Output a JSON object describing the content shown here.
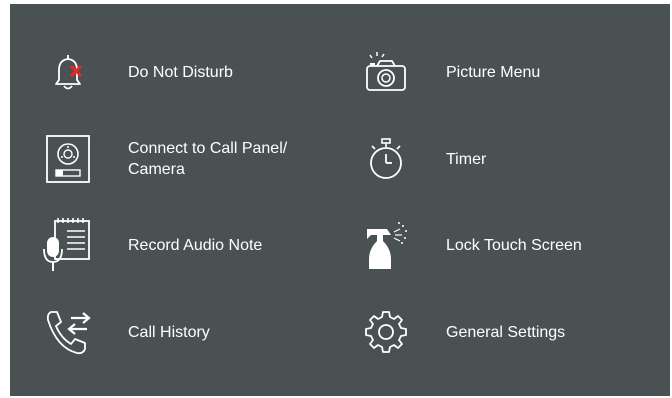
{
  "menu": {
    "left": [
      {
        "label": "Do Not Disturb",
        "icon": "bell-muted-icon"
      },
      {
        "label": "Connect to Call Panel/\nCamera",
        "icon": "call-panel-icon"
      },
      {
        "label": "Record Audio Note",
        "icon": "audio-note-icon"
      },
      {
        "label": "Call History",
        "icon": "call-history-icon"
      }
    ],
    "right": [
      {
        "label": "Picture Menu",
        "icon": "camera-icon"
      },
      {
        "label": "Timer",
        "icon": "stopwatch-icon"
      },
      {
        "label": "Lock Touch Screen",
        "icon": "cleaning-spray-icon"
      },
      {
        "label": "General Settings",
        "icon": "gear-icon"
      }
    ]
  },
  "colors": {
    "background": "#4a5152",
    "text": "#ffffff",
    "accent_red": "#e8262c"
  }
}
